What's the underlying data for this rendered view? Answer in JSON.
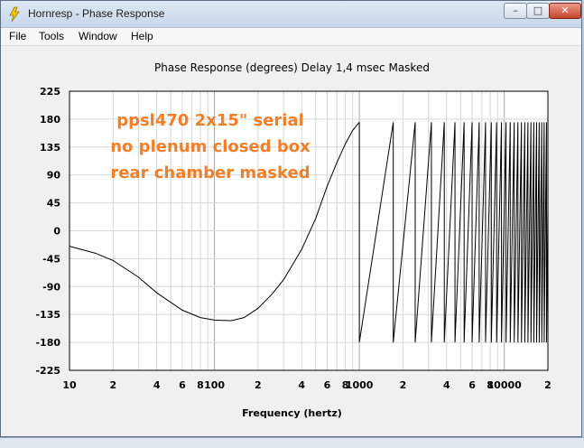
{
  "window": {
    "title": "Hornresp - Phase Response",
    "controls": {
      "minimize": "–",
      "maximize": "□",
      "close": "✕"
    }
  },
  "menu": [
    {
      "label": "File"
    },
    {
      "label": "Tools"
    },
    {
      "label": "Window"
    },
    {
      "label": "Help"
    }
  ],
  "chart": {
    "title": "Phase Response (degrees)   Delay 1,4 msec   Masked",
    "xlabel": "Frequency (hertz)",
    "annotation": [
      "ppsl470 2x15\" serial",
      "no plenum closed box",
      "rear chamber masked"
    ],
    "annotation_color": "#f07f2a"
  },
  "chart_data": {
    "type": "line",
    "title": "Phase Response (degrees)   Delay 1,4 msec   Masked",
    "xlabel": "Frequency (hertz)",
    "ylabel": "",
    "x_scale": "log",
    "xlim": [
      10,
      20000
    ],
    "ylim": [
      -225,
      225
    ],
    "y_ticks": [
      225,
      180,
      135,
      90,
      45,
      0,
      -45,
      -90,
      -135,
      -180,
      -225
    ],
    "x_tick_labels": [
      {
        "value": 10,
        "label": "10"
      },
      {
        "value": 20,
        "label": "2"
      },
      {
        "value": 40,
        "label": "4"
      },
      {
        "value": 60,
        "label": "6"
      },
      {
        "value": 80,
        "label": "8"
      },
      {
        "value": 100,
        "label": "100"
      },
      {
        "value": 200,
        "label": "2"
      },
      {
        "value": 400,
        "label": "4"
      },
      {
        "value": 600,
        "label": "6"
      },
      {
        "value": 800,
        "label": "8"
      },
      {
        "value": 1000,
        "label": "1000"
      },
      {
        "value": 2000,
        "label": "2"
      },
      {
        "value": 4000,
        "label": "4"
      },
      {
        "value": 6000,
        "label": "6"
      },
      {
        "value": 8000,
        "label": "8"
      },
      {
        "value": 10000,
        "label": "10000"
      },
      {
        "value": 20000,
        "label": "2"
      }
    ],
    "grid": true,
    "series": [
      {
        "color": "#000000",
        "x": [
          10,
          15,
          20,
          30,
          40,
          60,
          80,
          100,
          130,
          160,
          200,
          250,
          300,
          400,
          500,
          600,
          700,
          800,
          900,
          1000
        ],
        "y": [
          -25,
          -36,
          -48,
          -75,
          -100,
          -128,
          -140,
          -144,
          -145,
          -140,
          -125,
          -102,
          -79,
          -30,
          20,
          72,
          110,
          140,
          162,
          175
        ]
      },
      {
        "color": "#000000",
        "wrap_series": true,
        "start_freq": 1000,
        "end_freq": 20000,
        "period_hz": 714,
        "min_deg": -180,
        "max_deg": 175
      }
    ]
  }
}
